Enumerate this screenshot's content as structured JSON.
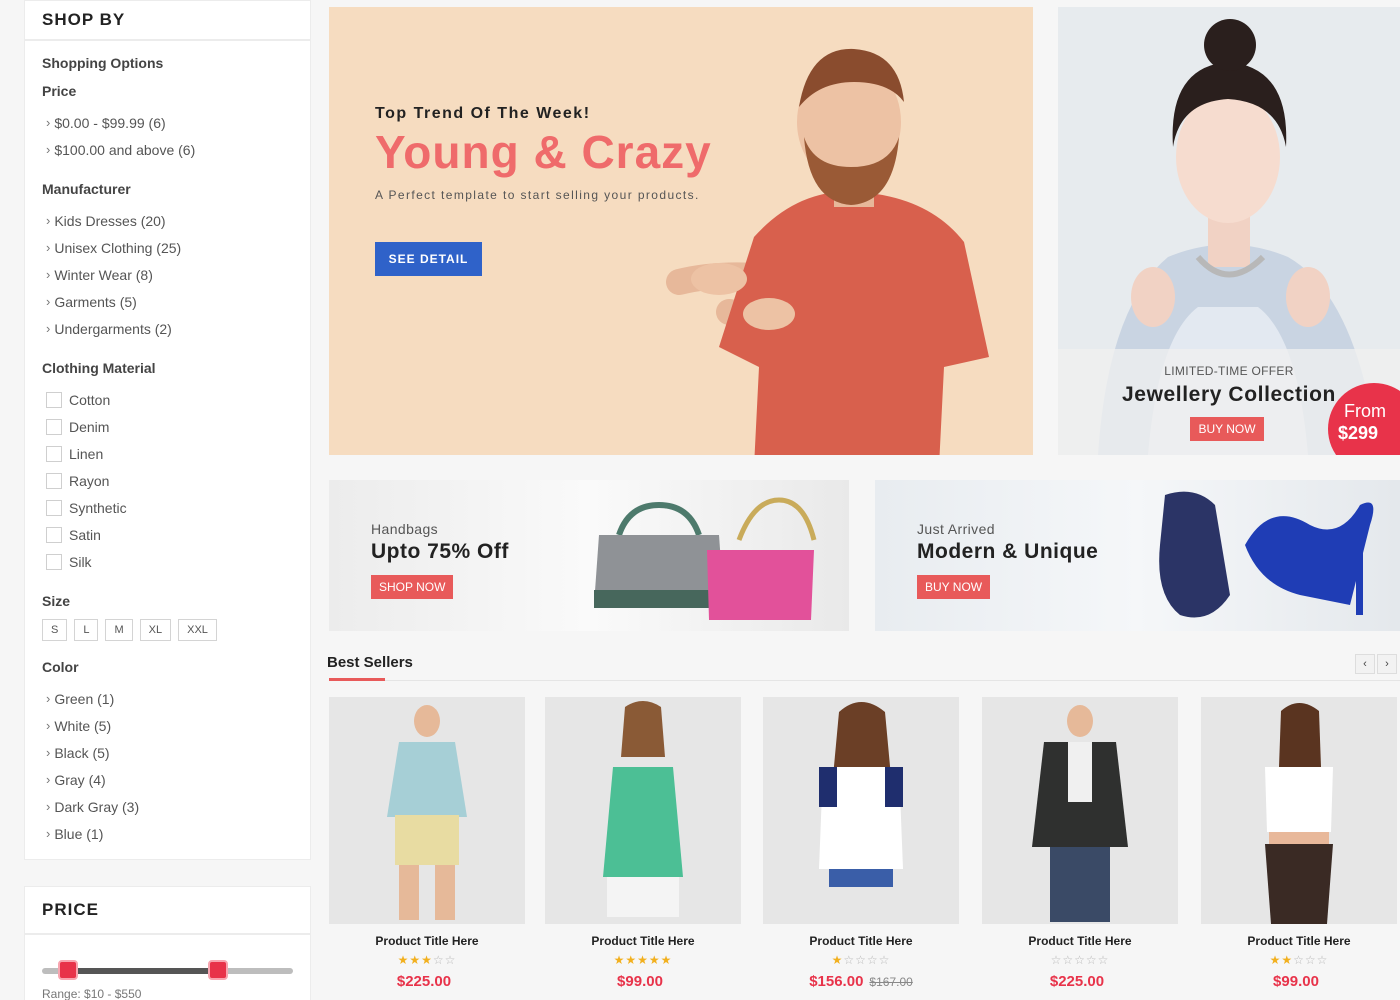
{
  "sidebar": {
    "shop_by": "SHOP BY",
    "shopping_options": "Shopping Options",
    "price_title": "Price",
    "price_items": [
      "$0.00 - $99.99 (6)",
      "$100.00 and above (6)"
    ],
    "manufacturer_title": "Manufacturer",
    "manufacturer_items": [
      "Kids Dresses (20)",
      "Unisex Clothing (25)",
      "Winter Wear (8)",
      "Garments (5)",
      "Undergarments (2)"
    ],
    "material_title": "Clothing Material",
    "material_items": [
      "Cotton",
      "Denim",
      "Linen",
      "Rayon",
      "Synthetic",
      "Satin",
      "Silk"
    ],
    "size_title": "Size",
    "sizes": [
      "S",
      "L",
      "M",
      "XL",
      "XXL"
    ],
    "color_title": "Color",
    "color_items": [
      "Green (1)",
      "White (5)",
      "Black (5)",
      "Gray (4)",
      "Dark Gray (3)",
      "Blue (1)"
    ],
    "price_panel_title": "PRICE",
    "price_range_text": "Range: $10 - $550",
    "price_slider": {
      "low_fraction": 0.1,
      "high_fraction": 0.7
    }
  },
  "hero": {
    "kicker": "Top Trend Of The Week!",
    "title": "Young & Crazy",
    "subtitle": "A Perfect template to start selling your products.",
    "button": "SEE DETAIL"
  },
  "jewellery": {
    "kicker": "LIMITED-TIME OFFER",
    "title": "Jewellery Collection",
    "button": "BUY NOW",
    "badge_line1": "From",
    "badge_line2": "$299"
  },
  "promos": [
    {
      "kicker": "Handbags",
      "title": "Upto 75% Off",
      "button": "SHOP NOW"
    },
    {
      "kicker": "Just Arrived",
      "title": "Modern & Unique",
      "button": "BUY NOW"
    }
  ],
  "best_sellers": {
    "title": "Best Sellers",
    "prev_icon": "‹",
    "next_icon": "›",
    "products": [
      {
        "title": "Product Title Here",
        "rating": 3,
        "price": "$225.00",
        "old_price": ""
      },
      {
        "title": "Product Title Here",
        "rating": 5,
        "price": "$99.00",
        "old_price": ""
      },
      {
        "title": "Product Title Here",
        "rating": 1,
        "price": "$156.00",
        "old_price": "$167.00"
      },
      {
        "title": "Product Title Here",
        "rating": 0,
        "price": "$225.00",
        "old_price": ""
      },
      {
        "title": "Product Title Here",
        "rating": 2,
        "price": "$99.00",
        "old_price": ""
      }
    ]
  },
  "colors": {
    "accent": "#e8334a",
    "hero_title": "#ef6b6b",
    "hero_button": "#2f62c9",
    "hero_bg": "#f6dcc0"
  }
}
